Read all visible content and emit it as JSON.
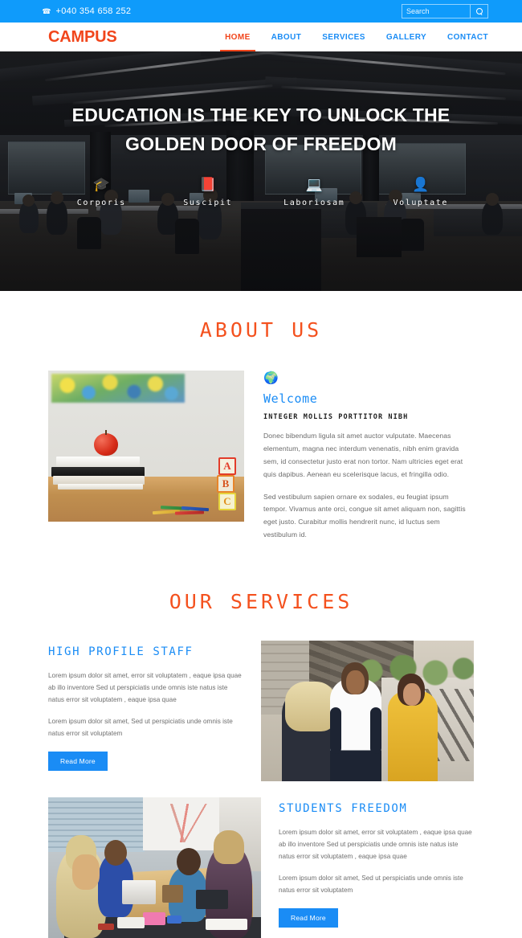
{
  "topbar": {
    "phone": "+040 354 658 252",
    "phone_icon": "phone-icon",
    "search_placeholder": "Search",
    "search_value": "",
    "search_icon": "search-icon"
  },
  "nav": {
    "logo": "CAMPUS",
    "links": [
      {
        "label": "HOME",
        "active": true
      },
      {
        "label": "ABOUT",
        "active": false
      },
      {
        "label": "SERVICES",
        "active": false
      },
      {
        "label": "GALLERY",
        "active": false
      },
      {
        "label": "CONTACT",
        "active": false
      }
    ]
  },
  "hero": {
    "title": "EDUCATION IS THE KEY TO UNLOCK THE GOLDEN DOOR OF FREEDOM",
    "features": [
      {
        "label": "Corporis",
        "icon": "graduation-cap-icon",
        "glyph": "🎓"
      },
      {
        "label": "Suscipit",
        "icon": "book-icon",
        "glyph": "📕"
      },
      {
        "label": "Laboriosam",
        "icon": "laptop-icon",
        "glyph": "💻"
      },
      {
        "label": "Voluptate",
        "icon": "user-icon",
        "glyph": "👤"
      }
    ]
  },
  "about": {
    "heading": "ABOUT US",
    "image_alt": "apple-on-books-classroom-photo",
    "globe_icon": "globe-icon",
    "globe_glyph": "🌍",
    "welcome": "Welcome",
    "subheading": "INTEGER MOLLIS PORTTITOR NIBH",
    "paragraphs": [
      "Donec bibendum ligula sit amet auctor vulputate. Maecenas elementum, magna nec interdum venenatis, nibh enim gravida sem, id consectetur justo erat non tortor. Nam ultricies eget erat quis dapibus. Aenean eu scelerisque lacus, et fringilla odio.",
      "Sed vestibulum sapien ornare ex sodales, eu feugiat ipsum tempor. Vivamus ante orci, congue sit amet aliquam non, sagittis eget justo. Curabitur mollis hendrerit nunc, id luctus sem vestibulum id."
    ]
  },
  "services": {
    "heading": "OUR SERVICES",
    "items": [
      {
        "title": "HIGH PROFILE STAFF",
        "paragraphs": [
          "Lorem ipsum dolor sit amet, error sit voluptatem , eaque ipsa quae ab illo inventore Sed ut perspiciatis unde omnis iste natus iste natus error sit voluptatem , eaque ipsa quae",
          "Lorem ipsum dolor sit amet, Sed ut perspiciatis unde omnis iste natus error sit voluptatem"
        ],
        "button": "Read More",
        "image_alt": "three-students-talking-outdoors-photo"
      },
      {
        "title": "STUDENTS FREEDOM",
        "paragraphs": [
          "Lorem ipsum dolor sit amet, error sit voluptatem , eaque ipsa quae ab illo inventore Sed ut perspiciatis unde omnis iste natus iste natus error sit voluptatem , eaque ipsa quae",
          "Lorem ipsum dolor sit amet, Sed ut perspiciatis unde omnis iste natus error sit voluptatem"
        ],
        "button": "Read More",
        "image_alt": "students-collaborating-at-table-photo"
      }
    ]
  },
  "colors": {
    "brand_orange": "#f1451b",
    "accent_blue": "#1a8cf5",
    "topbar_blue": "#0f9bfb",
    "heading_orange": "#f4511e",
    "body_text": "#6a6a6a"
  }
}
